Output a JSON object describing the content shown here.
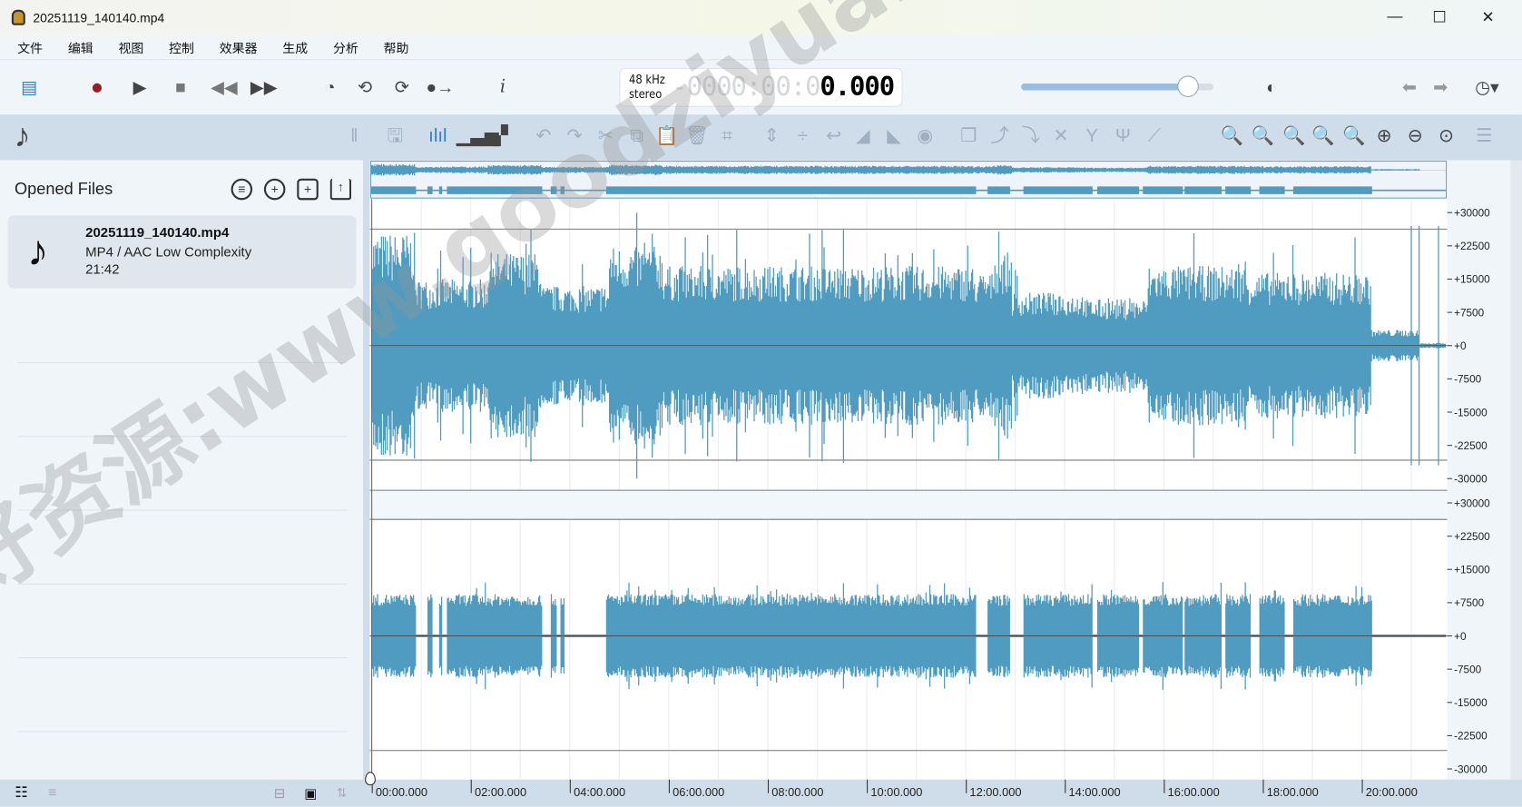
{
  "window": {
    "title": "20251119_140140.mp4"
  },
  "menu": [
    "文件",
    "编辑",
    "视图",
    "控制",
    "效果器",
    "生成",
    "分析",
    "帮助"
  ],
  "time_display": {
    "rate": "48 kHz",
    "channels": "stereo",
    "dim": "-0000:00:0",
    "value": "0.000"
  },
  "volume": {
    "level": 0.87
  },
  "sidebar": {
    "title": "Opened Files",
    "file": {
      "name": "20251119_140140.mp4",
      "format": "MP4 / AAC Low Complexity",
      "duration": "21:42"
    }
  },
  "axis": {
    "y_labels": [
      "+30000",
      "+22500",
      "+15000",
      "+7500",
      "+0",
      "-7500",
      "-15000",
      "-22500",
      "-30000"
    ],
    "x_labels": [
      "00:00.000",
      "02:00.000",
      "04:00.000",
      "06:00.000",
      "08:00.000",
      "10:00.000",
      "12:00.000",
      "14:00.000",
      "16:00.000",
      "18:00.000",
      "20:00.000"
    ]
  },
  "watermark": "好资源:www.goodziyuan.com",
  "colors": {
    "wave": "#4f9cc0",
    "accent": "#2f7fd8",
    "record": "#9b1c1c"
  }
}
